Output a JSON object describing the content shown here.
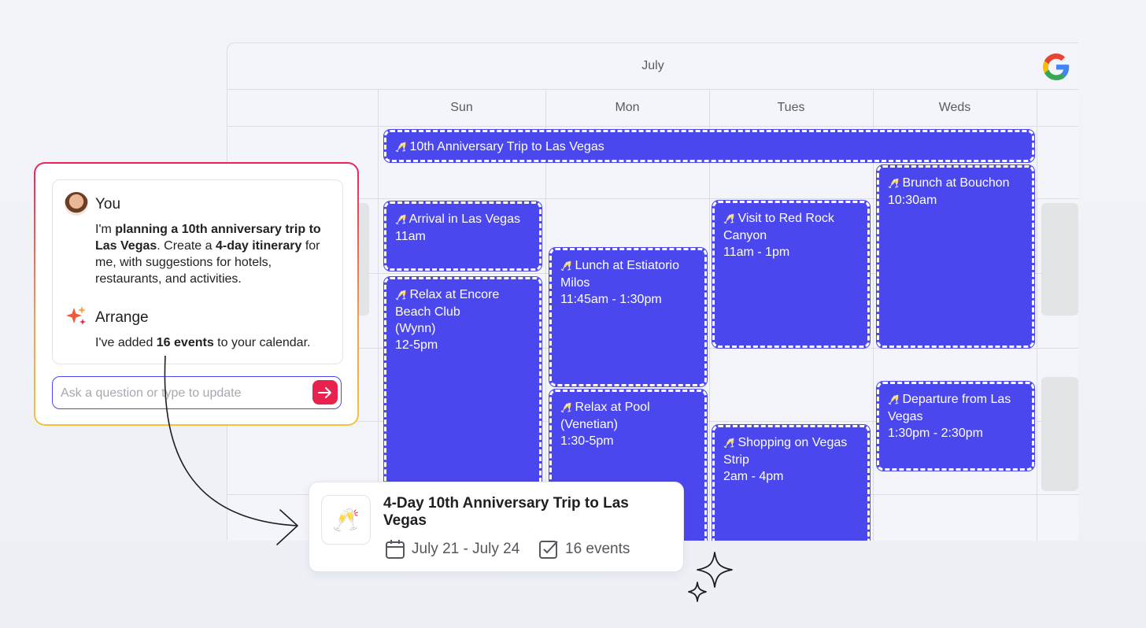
{
  "calendar": {
    "month": "July",
    "days": [
      "Sun",
      "Mon",
      "Tues",
      "Weds"
    ],
    "events": [
      {
        "title": "10th Anniversary Trip to Las Vegas",
        "time": ""
      },
      {
        "title": "Arrival in Las Vegas",
        "time": "11am"
      },
      {
        "title": "Relax at Encore Beach Club (Wynn)",
        "lines": [
          "Relax at Encore",
          "Beach Club",
          "(Wynn)"
        ],
        "time": "12-5pm"
      },
      {
        "title": "Lunch at Estiatorio Milos",
        "lines": [
          "Lunch at Estiatorio",
          "Milos"
        ],
        "time": "11:45am - 1:30pm"
      },
      {
        "title": "Relax at Pool (Venetian)",
        "lines": [
          "Relax at Pool",
          "(Venetian)"
        ],
        "time": "1:30-5pm"
      },
      {
        "title": "Visit to Red Rock Canyon",
        "lines": [
          "Visit to Red Rock",
          "Canyon"
        ],
        "time": "11am - 1pm"
      },
      {
        "title": "Shopping on Vegas Strip",
        "lines": [
          "Shopping on Vegas",
          "Strip"
        ],
        "time": "2am - 4pm"
      },
      {
        "title": "Brunch at Bouchon",
        "time": "10:30am"
      },
      {
        "title": "Departure from Las Vegas",
        "lines": [
          "Departure from Las",
          "Vegas"
        ],
        "time": "1:30pm - 2:30pm"
      }
    ],
    "event_icon": "champagne-icon",
    "event_color": "#4b47ee"
  },
  "chat": {
    "user_name": "You",
    "user_message_parts": [
      "I'm ",
      "planning a 10th anniversary trip to Las Vegas",
      ". Create a ",
      "4-day itinerary",
      " for me, with suggestions for hotels, restaurants, and activities."
    ],
    "assistant_name": "Arrange",
    "assistant_message_parts": [
      "I've added ",
      "16 events",
      " to your calendar."
    ],
    "input_placeholder": "Ask a question or type to update",
    "send_color": "#e8214f"
  },
  "summary": {
    "title": "4-Day 10th Anniversary Trip to Las Vegas",
    "dates": "July 21 - July 24",
    "events_count": "16 events",
    "icon": "champagne-glasses-icon"
  }
}
